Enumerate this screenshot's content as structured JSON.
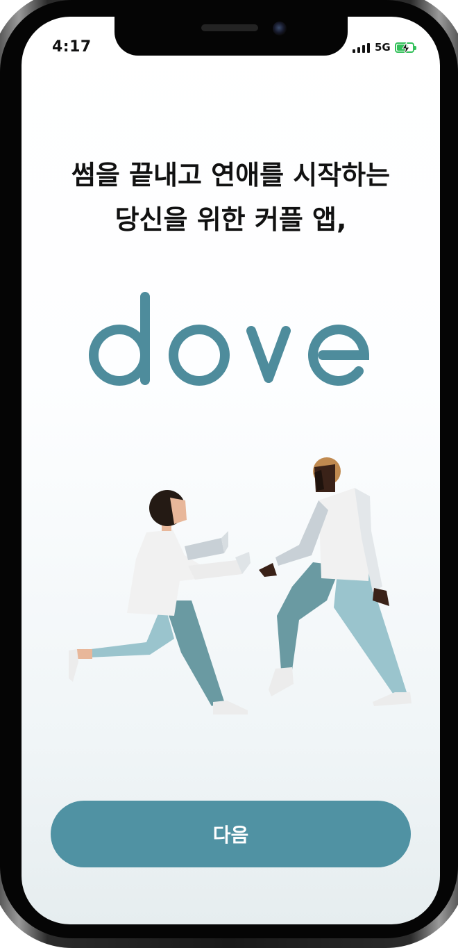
{
  "status_bar": {
    "time": "4:17",
    "network": "5G",
    "battery_color": "#33c05a"
  },
  "onboarding": {
    "headline_line1": "썸을 끝내고 연애를 시작하는",
    "headline_line2": "당신을 위한 커플 앱,",
    "logo_text": "dove",
    "illustration": "couple-running-illustration",
    "next_label": "다음"
  },
  "colors": {
    "brand": "#4e8c9c",
    "button": "#5092a3",
    "button_text": "#ffffff",
    "headline": "#111111"
  }
}
